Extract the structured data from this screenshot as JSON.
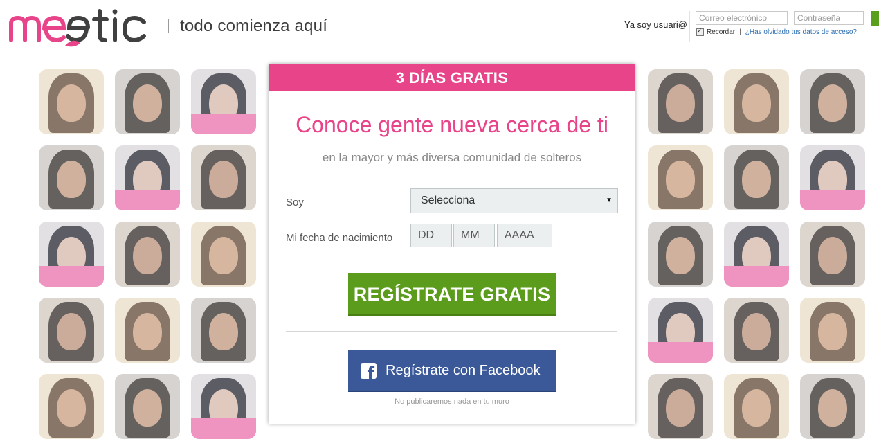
{
  "header": {
    "tagline": "todo comienza aquí",
    "login_label": "Ya soy usuari@",
    "email_placeholder": "Correo electrónico",
    "password_placeholder": "Contraseña",
    "remember_label": "Recordar",
    "separator": "|",
    "forgot_link": "¿Has olvidado tus datos de acceso?"
  },
  "modal": {
    "banner": "3 DÍAS GRATIS",
    "headline": "Conoce gente nueva cerca de ti",
    "subheadline": "en la mayor y más diversa comunidad de solteros",
    "gender_label": "Soy",
    "gender_select": "Selecciona",
    "birthdate_label": "Mi fecha de nacimiento",
    "day_placeholder": "DD",
    "month_placeholder": "MM",
    "year_placeholder": "AAAA",
    "register_button": "REGÍSTRATE GRATIS",
    "facebook_button": "Regístrate con Facebook",
    "facebook_note": "No publicaremos nada en tu muro"
  },
  "colors": {
    "brand_pink": "#e8448a",
    "register_green": "#5c9c1c",
    "facebook_blue": "#3b5998",
    "logo_dark": "#404040"
  },
  "icons": [
    "meetic-logo",
    "checkbox-checked-icon",
    "dropdown-arrow-icon",
    "facebook-icon"
  ]
}
